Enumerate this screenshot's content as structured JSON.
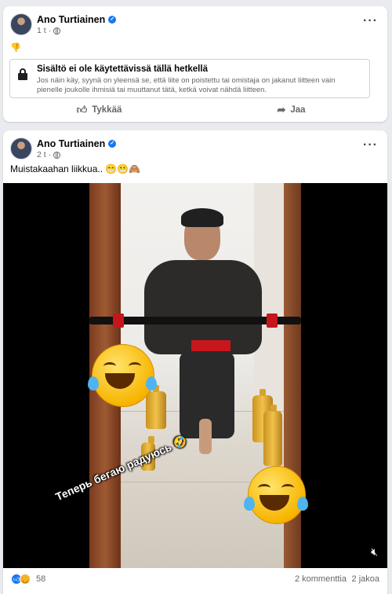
{
  "post1": {
    "author": "Ano Turtiainen",
    "time": "1 t",
    "dot": "·",
    "reaction_emoji": "👎",
    "unavailable": {
      "title": "Sisältö ei ole käytettävissä tällä hetkellä",
      "body": "Jos näin käy, syynä on yleensä se, että liite on poistettu tai omistaja on jakanut liitteen vain pienelle joukolle ihmisiä tai muuttanut tätä, ketkä voivat nähdä liitteen."
    },
    "like_label": "Tykkää",
    "share_label": "Jaa"
  },
  "post2": {
    "author": "Ano Turtiainen",
    "time": "2 t",
    "dot": "·",
    "caption": "Muistakaahan liikkua.. 😁😬🙈",
    "video": {
      "overlay_text": "Теперь бегаю радуюсь 🤣",
      "muted": true
    },
    "reactions_count": "58",
    "comments": "2 kommenttia",
    "shares": "2 jakoa"
  },
  "colors": {
    "brand": "#1877f2",
    "secondary_text": "#65676b"
  }
}
